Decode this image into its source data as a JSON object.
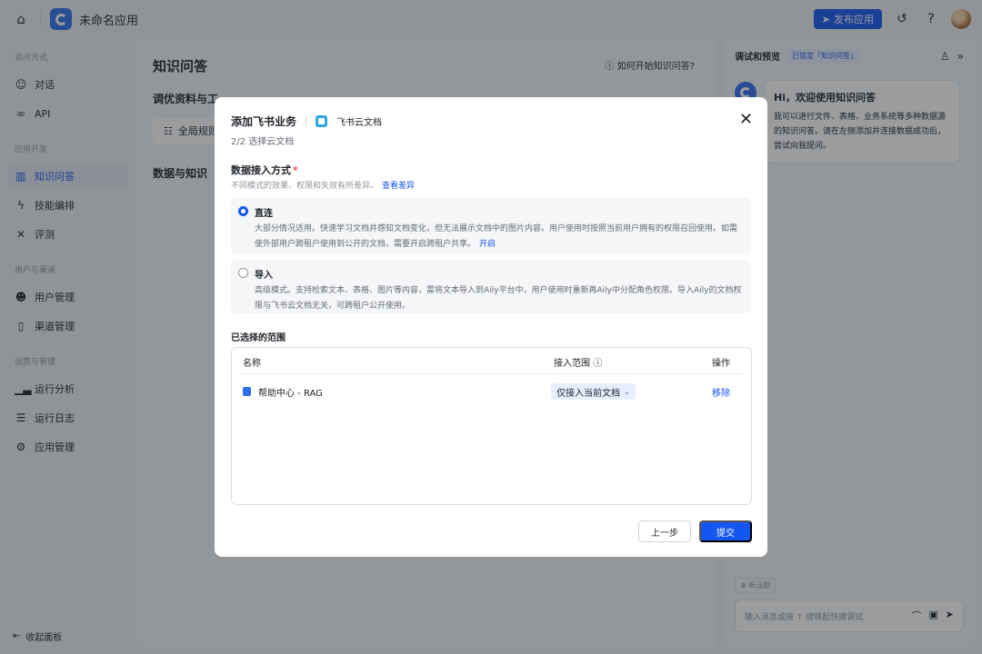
{
  "topbar": {
    "app_name": "未命名应用",
    "publish_label": "发布应用"
  },
  "sidebar": {
    "groups": [
      {
        "title": "访问方式",
        "items": [
          {
            "label": "对话",
            "icon": "chat-icon"
          },
          {
            "label": "API",
            "icon": "link-icon"
          }
        ]
      },
      {
        "title": "应用开发",
        "items": [
          {
            "label": "知识问答",
            "icon": "book-icon",
            "active": true
          },
          {
            "label": "技能编排",
            "icon": "bolt-icon"
          },
          {
            "label": "评测",
            "icon": "tools-icon"
          }
        ]
      },
      {
        "title": "用户与渠道",
        "items": [
          {
            "label": "用户管理",
            "icon": "users-icon"
          },
          {
            "label": "渠道管理",
            "icon": "channel-icon"
          }
        ]
      },
      {
        "title": "运营与管理",
        "items": [
          {
            "label": "运行分析",
            "icon": "bar-chart-icon"
          },
          {
            "label": "运行日志",
            "icon": "log-icon"
          },
          {
            "label": "应用管理",
            "icon": "gear-icon"
          }
        ]
      }
    ],
    "collapse_label": "收起面板"
  },
  "main": {
    "title": "知识问答",
    "help_link": "如何开始知识问答?",
    "section_tune": "调优资料与工",
    "rule_btn": "全局规则",
    "section_data": "数据与知识"
  },
  "panel": {
    "title": "调试和预览",
    "lock_badge": "已锁定「知识问答」",
    "welcome_title": "Hi，欢迎使用知识问答",
    "welcome_text": "我可以进行文件、表格、业务系统等多种数据源的知识问答。请在左侧添加并连接数据成功后，尝试向我提问。",
    "new_topic": "新话题",
    "input_placeholder": "输入消息或按 ↑ 键唤起快捷调试"
  },
  "modal": {
    "title": "添加飞书业务",
    "source": "飞书云文档",
    "step": "2/2 选择云文档",
    "field_label": "数据接入方式",
    "required_mark": "*",
    "field_hint": "不同模式的效果、权限和失效有所差异。",
    "hint_link": "查看差异",
    "options": [
      {
        "title": "直连",
        "desc": "大部分情况适用。快速学习文档并感知文档变化，但无法展示文档中的图片内容。用户使用时按照当前用户拥有的权限召回使用。如需使外部用户跨租户使用到公开的文档，需要开启跨租户共享。",
        "link": "开启",
        "selected": true
      },
      {
        "title": "导入",
        "desc": "高级模式。支持检索文本、表格、图片等内容，需将文本导入到Aily平台中，用户使用时重新再Aily中分配角色权限。导入Aily的文档权限与飞书云文档无关，可跨租户公开使用。",
        "selected": false
      }
    ],
    "scope_label": "已选择的范围",
    "table": {
      "headers": {
        "name": "名称",
        "scope": "接入范围",
        "op": "操作"
      },
      "rows": [
        {
          "name": "帮助中心 - RAG",
          "scope": "仅接入当前文档",
          "action": "移除"
        }
      ]
    },
    "btn_prev": "上一步",
    "btn_submit": "提交"
  }
}
